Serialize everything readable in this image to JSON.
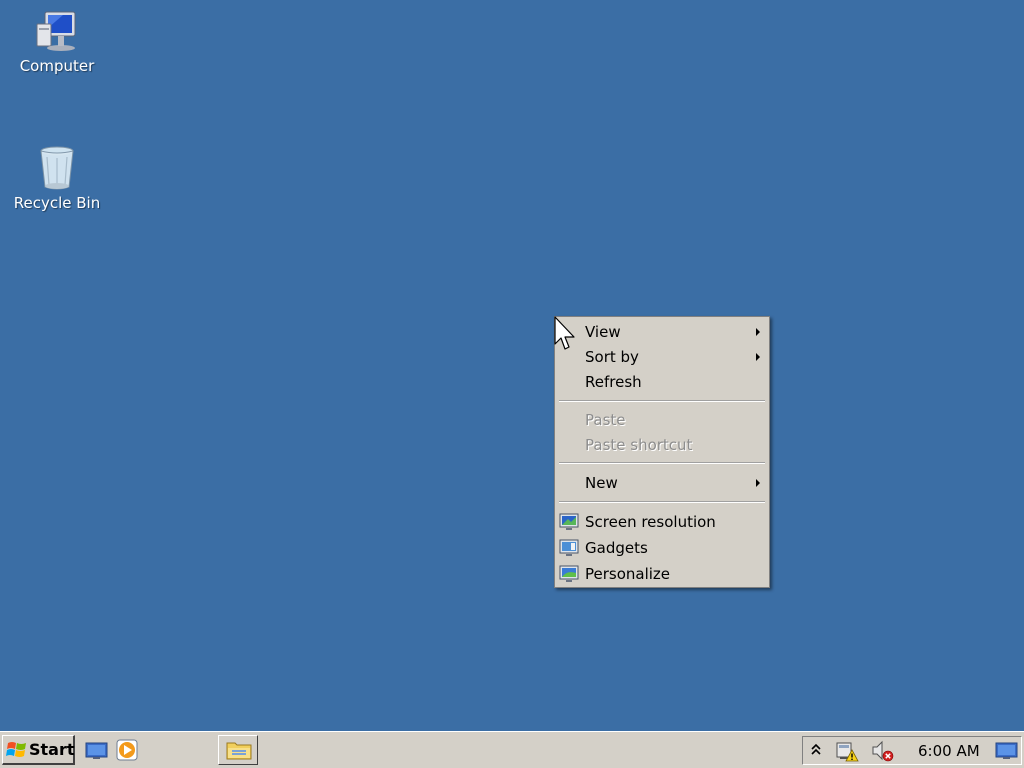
{
  "desktop": {
    "background_color": "#3b6ea5",
    "icons": [
      {
        "label": "Computer",
        "icon": "computer-icon"
      },
      {
        "label": "Recycle Bin",
        "icon": "recycle-bin-icon"
      }
    ]
  },
  "context_menu": {
    "items": [
      {
        "label": "View",
        "submenu": true,
        "enabled": true
      },
      {
        "label": "Sort by",
        "submenu": true,
        "enabled": true
      },
      {
        "label": "Refresh",
        "submenu": false,
        "enabled": true
      },
      {
        "label": "Paste",
        "submenu": false,
        "enabled": false
      },
      {
        "label": "Paste shortcut",
        "submenu": false,
        "enabled": false
      },
      {
        "label": "New",
        "submenu": true,
        "enabled": true
      },
      {
        "label": "Screen resolution",
        "icon": "monitor-icon",
        "enabled": true
      },
      {
        "label": "Gadgets",
        "icon": "gadgets-icon",
        "enabled": true
      },
      {
        "label": "Personalize",
        "icon": "personalize-icon",
        "enabled": true
      }
    ]
  },
  "taskbar": {
    "start_label": "Start",
    "quick_launch": [
      "show-desktop-icon",
      "media-player-icon"
    ],
    "open_windows": [
      "windows-explorer-icon"
    ],
    "tray": {
      "icons": [
        "show-hidden-icons-chevron",
        "network-warning-icon",
        "volume-muted-icon"
      ],
      "clock": "6:00 AM"
    }
  }
}
